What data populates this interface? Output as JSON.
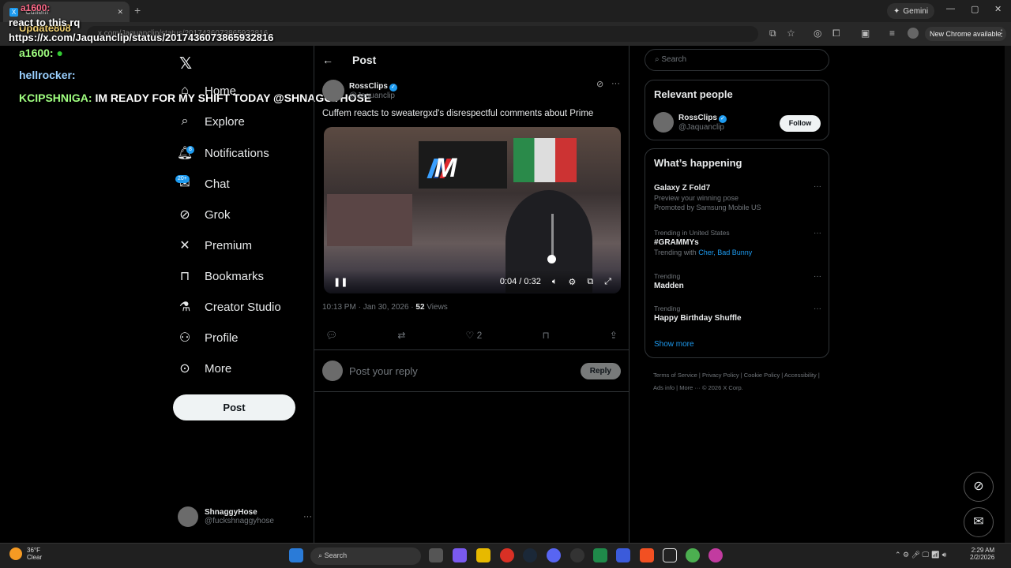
{
  "browser": {
    "tab_title": "\"Cuffem",
    "url": "x.com/Jaquanclip/status/2017436073865932816",
    "gemini_label": "Gemini",
    "new_chrome_label": "New Chrome available"
  },
  "stream_overlay": {
    "line1_user": "a1600:",
    "line2_user": "Update808",
    "line2_text": "react to this rq",
    "line3_text": "https://x.com/Jaquanclip/status/2017436073865932816",
    "line4_user": "a1600:",
    "line5_user": "hellrocker:",
    "line6_user": "KCIPSHNIGA:",
    "line6_text": "IM READY FOR MY SHIFT TODAY @SHNAGGYHOSE"
  },
  "nav": {
    "items": [
      {
        "label": "Home",
        "icon": "home-icon"
      },
      {
        "label": "Explore",
        "icon": "search-icon"
      },
      {
        "label": "Notifications",
        "icon": "bell-icon",
        "badge": "8"
      },
      {
        "label": "Chat",
        "icon": "mail-icon",
        "badge": "20+"
      },
      {
        "label": "Grok",
        "icon": "grok-icon"
      },
      {
        "label": "Premium",
        "icon": "x-icon"
      },
      {
        "label": "Bookmarks",
        "icon": "bookmark-icon"
      },
      {
        "label": "Creator Studio",
        "icon": "flask-icon"
      },
      {
        "label": "Profile",
        "icon": "person-icon"
      },
      {
        "label": "More",
        "icon": "more-circle-icon"
      }
    ],
    "post_button": "Post",
    "account_name": "ShnaggyHose",
    "account_handle": "@fuckshnaggyhose"
  },
  "post": {
    "header": "Post",
    "author_name": "RossClips",
    "author_handle": "@Jaquanclip",
    "text": "Cuffem reacts to sweatergxd's disrespectful comments about Prime",
    "video_time": "0:04 / 0:32",
    "time": "10:13 PM · Jan 30, 2026 · ",
    "views_count": "52",
    "views_label": " Views",
    "likes": "2",
    "reply_placeholder": "Post your reply",
    "reply_button": "Reply"
  },
  "sidebar": {
    "search_placeholder": "Search",
    "relevant_title": "Relevant people",
    "relevant_name": "RossClips",
    "relevant_handle": "@Jaquanclip",
    "follow_label": "Follow",
    "happening_title": "What’s happening",
    "trends": [
      {
        "line1": "",
        "title": "Galaxy Z Fold7",
        "sub": "Preview your winning pose",
        "extra": "Promoted by Samsung Mobile US"
      },
      {
        "line1": "Trending in United States",
        "title": "#GRAMMYs",
        "sub": "Trending with",
        "links": "Cher, Bad Bunny"
      },
      {
        "line1": "Trending",
        "title": "Madden"
      },
      {
        "line1": "Trending",
        "title": "Happy Birthday Shuffle"
      }
    ],
    "show_more": "Show more",
    "footer": "Terms of Service  |  Privacy Policy  |  Cookie Policy  |  Accessibility  |  Ads info  |  More ···  © 2026 X Corp."
  },
  "taskbar": {
    "weather_temp": "36°F",
    "weather_desc": "Clear",
    "search_label": "Search",
    "time": "2:29 AM",
    "date": "2/2/2026"
  }
}
